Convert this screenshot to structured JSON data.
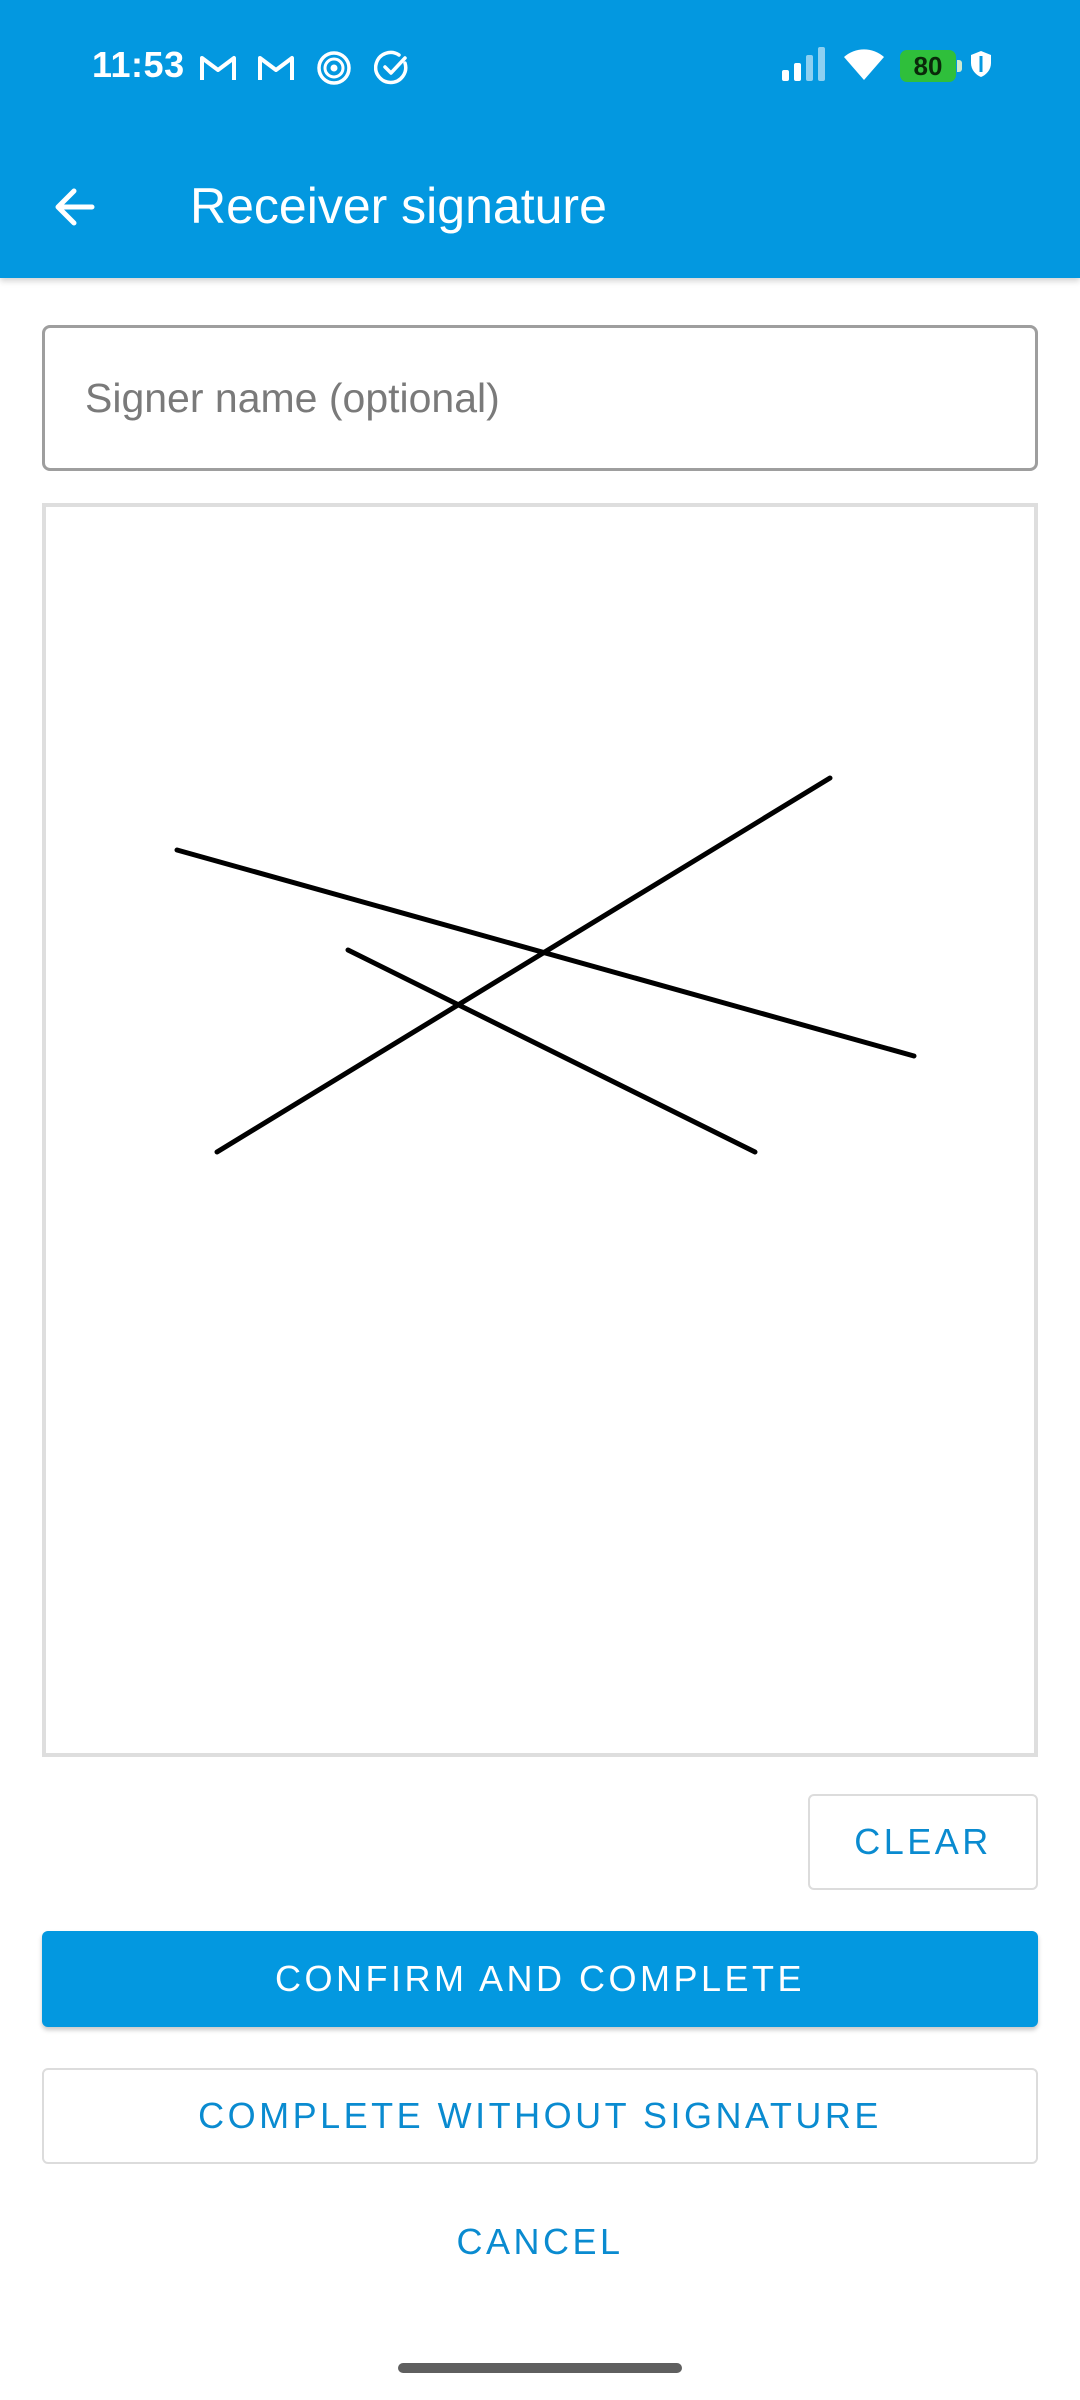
{
  "status_bar": {
    "time": "11:53",
    "notification_icons": [
      "gmail-icon",
      "gmail-icon",
      "spiral-app-icon",
      "check-circle-icon"
    ],
    "system_icons": [
      "signal-icon",
      "wifi-icon",
      "battery-icon",
      "shield-icon"
    ],
    "battery_level": "80"
  },
  "app_bar": {
    "back_icon": "arrow-back-icon",
    "title": "Receiver signature"
  },
  "form": {
    "signer_name": {
      "value": "",
      "placeholder": "Signer name (optional)"
    }
  },
  "signature_pad": {
    "has_signature": true
  },
  "actions": {
    "clear_label": "CLEAR",
    "confirm_label": "CONFIRM AND COMPLETE",
    "without_signature_label": "COMPLETE WITHOUT SIGNATURE",
    "cancel_label": "CANCEL"
  },
  "colors": {
    "primary": "#0398e0",
    "accent_text": "#0a8bd0",
    "battery": "#2fbf3b"
  }
}
